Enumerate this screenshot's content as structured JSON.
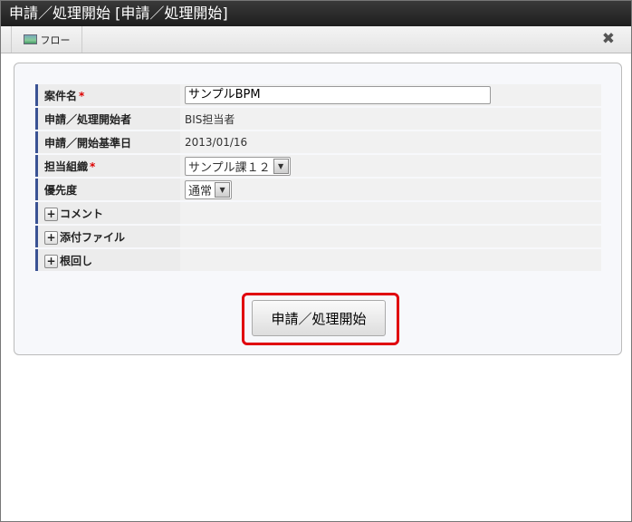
{
  "title": {
    "main": "申請／処理開始",
    "bracket": "[申請／処理開始]"
  },
  "toolbar": {
    "flow_tab": "フロー",
    "close_icon": "close-icon"
  },
  "form": {
    "matter_name": {
      "label": "案件名",
      "required": "*",
      "value": "サンプルBPM"
    },
    "applicant": {
      "label": "申請／処理開始者",
      "value": "BIS担当者"
    },
    "base_date": {
      "label": "申請／開始基準日",
      "value": "2013/01/16"
    },
    "org": {
      "label": "担当組織",
      "required": "*",
      "value": "サンプル課１２"
    },
    "priority": {
      "label": "優先度",
      "value": "通常"
    },
    "comment": {
      "label": "コメント"
    },
    "attachment": {
      "label": "添付ファイル"
    },
    "nemawashi": {
      "label": "根回し"
    }
  },
  "submit_label": "申請／処理開始"
}
